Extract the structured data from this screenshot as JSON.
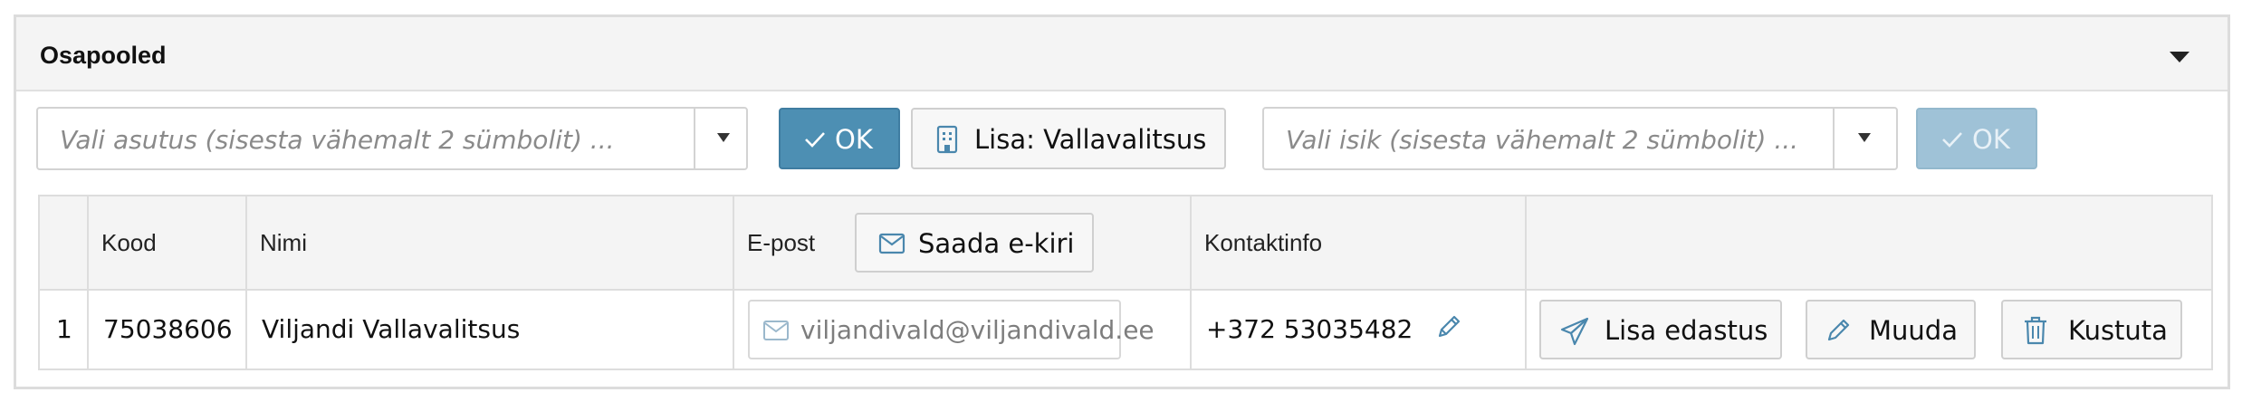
{
  "panel": {
    "title": "Osapooled"
  },
  "toolbar": {
    "institution_placeholder": "Vali asutus (sisesta vähemalt 2 sümbolit) ...",
    "institution_ok_label": "OK",
    "add_label": "Lisa: Vallavalitsus",
    "person_placeholder": "Vali isik (sisesta vähemalt 2 sümbolit) ...",
    "person_ok_label": "OK"
  },
  "table": {
    "headers": {
      "kood": "Kood",
      "nimi": "Nimi",
      "epost": "E-post",
      "kontakt": "Kontaktinfo"
    },
    "send_email_label": "Saada e-kiri",
    "rows": [
      {
        "index": "1",
        "kood": "75038606",
        "nimi": "Viljandi Vallavalitsus",
        "epost": "viljandivald@viljandivald.ee",
        "kontakt": "+372 53035482",
        "actions": {
          "forward": "Lisa edastus",
          "edit": "Muuda",
          "delete": "Kustuta"
        }
      }
    ]
  },
  "colors": {
    "primary": "#4d8fb3",
    "primary_disabled": "#9fc2d7",
    "icon_blue": "#4a87ad"
  },
  "icons": [
    "caret-down-icon",
    "check-icon",
    "building-icon",
    "envelope-icon",
    "pencil-icon",
    "paper-plane-icon",
    "trash-icon"
  ]
}
